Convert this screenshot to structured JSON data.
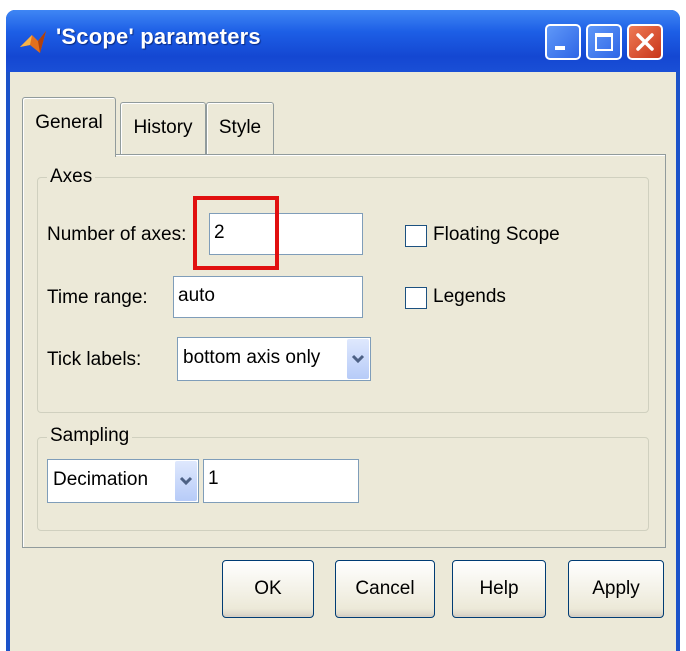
{
  "window": {
    "title": "'Scope' parameters"
  },
  "tabs": [
    {
      "label": "General",
      "active": true
    },
    {
      "label": "History",
      "active": false
    },
    {
      "label": "Style",
      "active": false
    }
  ],
  "axes": {
    "group_label": "Axes",
    "num_axes_label": "Number of axes:",
    "num_axes_value": "2",
    "time_range_label": "Time range:",
    "time_range_value": "auto",
    "tick_labels_label": "Tick labels:",
    "tick_labels_value": "bottom axis only",
    "floating_scope_label": "Floating Scope",
    "floating_scope_checked": false,
    "legends_label": "Legends",
    "legends_checked": false
  },
  "sampling": {
    "group_label": "Sampling",
    "mode_value": "Decimation",
    "factor_value": "1"
  },
  "buttons": {
    "ok": "OK",
    "cancel": "Cancel",
    "help": "Help",
    "apply": "Apply"
  },
  "colors": {
    "titlebar": "#1d5fe6",
    "dialog_bg": "#ece9d8",
    "highlight": "#e11010"
  }
}
